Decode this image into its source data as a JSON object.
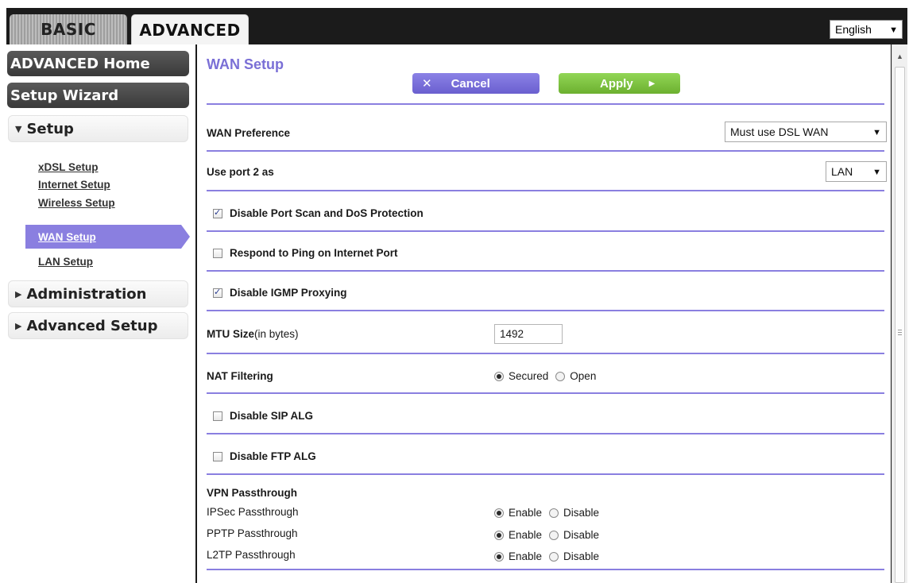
{
  "tabs": {
    "basic": "BASIC",
    "advanced": "ADVANCED"
  },
  "language": {
    "value": "English"
  },
  "sidebar": {
    "advanced_home": "ADVANCED Home",
    "setup_wizard": "Setup Wizard",
    "setup_header": "Setup",
    "setup_items": [
      {
        "label": "xDSL Setup"
      },
      {
        "label": "Internet Setup"
      },
      {
        "label": "Wireless Setup"
      },
      {
        "label": "WAN Setup",
        "active": true
      },
      {
        "label": "LAN Setup"
      }
    ],
    "administration": "Administration",
    "advanced_setup": "Advanced Setup"
  },
  "main": {
    "title": "WAN Setup",
    "cancel_label": "Cancel",
    "apply_label": "Apply",
    "wan_preference": {
      "label": "WAN Preference",
      "value": "Must use DSL WAN"
    },
    "port2": {
      "label": "Use port 2 as",
      "value": "LAN"
    },
    "disable_portscan": {
      "label": "Disable Port Scan and DoS Protection",
      "checked": true
    },
    "respond_ping": {
      "label": "Respond to Ping on Internet Port",
      "checked": false
    },
    "disable_igmp": {
      "label": "Disable IGMP Proxying",
      "checked": true
    },
    "mtu": {
      "label_bold": "MTU Size",
      "label_normal": "(in bytes)",
      "value": "1492"
    },
    "nat": {
      "label": "NAT Filtering",
      "options": [
        "Secured",
        "Open"
      ],
      "selected": "Secured"
    },
    "disable_sip": {
      "label": "Disable SIP ALG",
      "checked": false
    },
    "disable_ftp": {
      "label": "Disable FTP ALG",
      "checked": false
    },
    "vpn": {
      "title": "VPN Passthrough",
      "rows": [
        {
          "label": "IPSec Passthrough",
          "enable": "Enable",
          "disable": "Disable",
          "selected": "Enable"
        },
        {
          "label": "PPTP Passthrough",
          "enable": "Enable",
          "disable": "Disable",
          "selected": "Enable"
        },
        {
          "label": "L2TP Passthrough",
          "enable": "Enable",
          "disable": "Disable",
          "selected": "Enable"
        }
      ]
    }
  },
  "icons": {
    "cancel": "close-icon",
    "apply": "triangle-right-icon",
    "dropdown": "triangle-down-icon",
    "expand": "triangle-right-icon",
    "collapse": "triangle-down-icon"
  },
  "colors": {
    "accent": "#8a7fe0",
    "title": "#7a6fd6",
    "apply": "#7cc23e",
    "cancel": "#7a70db",
    "frame": "#1b1b1b"
  }
}
